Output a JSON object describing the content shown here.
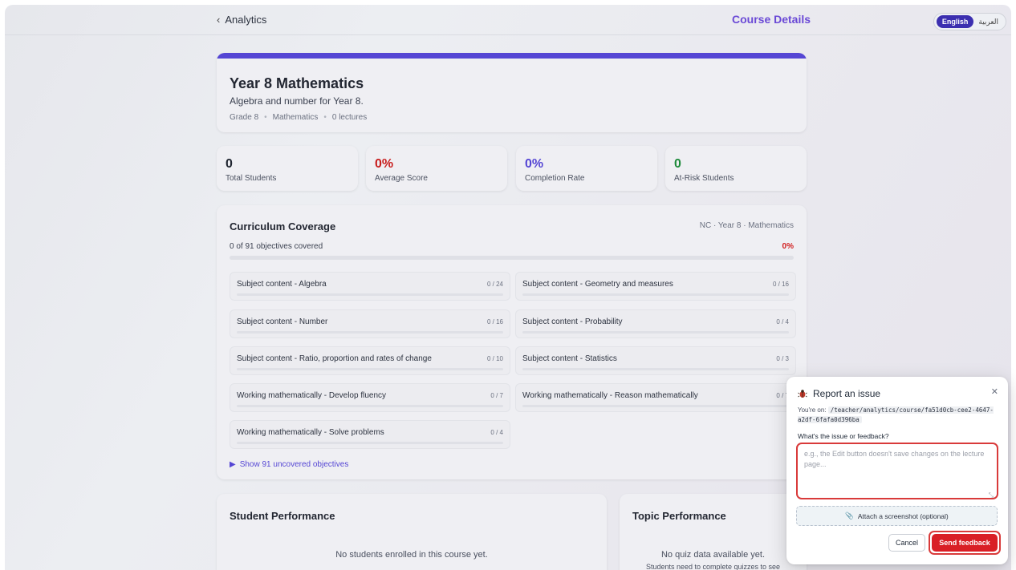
{
  "header": {
    "back_label": "Analytics",
    "title": "Course Details",
    "languages": {
      "active": "English",
      "inactive": "العربية"
    }
  },
  "course": {
    "title": "Year 8 Mathematics",
    "description": "Algebra and number for Year 8.",
    "grade": "Grade 8",
    "subject": "Mathematics",
    "lectures": "0 lectures",
    "accent_color": "#5546d4"
  },
  "stats": [
    {
      "value": "0",
      "label": "Total Students",
      "color": "#1f2530"
    },
    {
      "value": "0%",
      "label": "Average Score",
      "color": "#c81d1d"
    },
    {
      "value": "0%",
      "label": "Completion Rate",
      "color": "#5546d4"
    },
    {
      "value": "0",
      "label": "At-Risk Students",
      "color": "#1d8a3a"
    }
  ],
  "coverage": {
    "title": "Curriculum Coverage",
    "reference": "NC · Year 8 · Mathematics",
    "summary": "0 of 91 objectives covered",
    "percent": "0%",
    "objectives": [
      {
        "name": "Subject content - Algebra",
        "count": "0 / 24"
      },
      {
        "name": "Subject content - Geometry and measures",
        "count": "0 / 16"
      },
      {
        "name": "Subject content - Number",
        "count": "0 / 16"
      },
      {
        "name": "Subject content - Probability",
        "count": "0 / 4"
      },
      {
        "name": "Subject content - Ratio, proportion and rates of change",
        "count": "0 / 10"
      },
      {
        "name": "Subject content - Statistics",
        "count": "0 / 3"
      },
      {
        "name": "Working mathematically - Develop fluency",
        "count": "0 / 7"
      },
      {
        "name": "Working mathematically - Reason mathematically",
        "count": "0 / 7"
      },
      {
        "name": "Working mathematically - Solve problems",
        "count": "0 / 4"
      }
    ],
    "show_uncovered": "Show 91 uncovered objectives"
  },
  "student_performance": {
    "title": "Student Performance",
    "empty": "No students enrolled in this course yet."
  },
  "topic_performance": {
    "title": "Topic Performance",
    "empty": "No quiz data available yet.",
    "empty_hint": "Students need to complete quizzes to see"
  },
  "feedback": {
    "title": "Report an issue",
    "path_prefix": "You're on:",
    "path": "/teacher/analytics/course/fa51d0cb-cee2-4647-a2df-6fafa0d396ba",
    "question": "What's the issue or feedback?",
    "placeholder": "e.g., the Edit button doesn't save changes on the lecture page...",
    "attach_label": "Attach a screenshot (optional)",
    "cancel_label": "Cancel",
    "send_label": "Send feedback",
    "send_color": "#d91f26"
  }
}
